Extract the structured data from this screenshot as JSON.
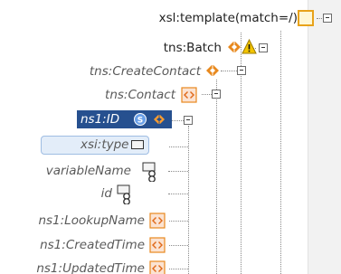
{
  "tree": {
    "nodes": [
      {
        "label": "xsl:template(match=/)",
        "icon": "template-folder-icon"
      },
      {
        "label": "tns:Batch",
        "icon": "element-warning-icon"
      },
      {
        "label": "tns:CreateContact",
        "icon": "element-icon"
      },
      {
        "label": "tns:Contact",
        "icon": "repeating-element-icon"
      },
      {
        "label": "ns1:ID",
        "icon": "simple-type-element-icon",
        "selected": true
      },
      {
        "label": "xsi:type",
        "icon": "xyz-attribute-icon"
      },
      {
        "label": "variableName",
        "icon": "xyz-attribute-icon"
      },
      {
        "label": "id",
        "icon": "xyz-attribute-icon"
      },
      {
        "label": "ns1:LookupName",
        "icon": "leaf-element-icon"
      },
      {
        "label": "ns1:CreatedTime",
        "icon": "leaf-element-icon"
      },
      {
        "label": "ns1:UpdatedTime",
        "icon": "leaf-element-icon"
      }
    ]
  },
  "colors": {
    "selection": "#26508f",
    "hover": "#e3edf9",
    "accent": "#e8891e",
    "warning": "#f3c400"
  }
}
